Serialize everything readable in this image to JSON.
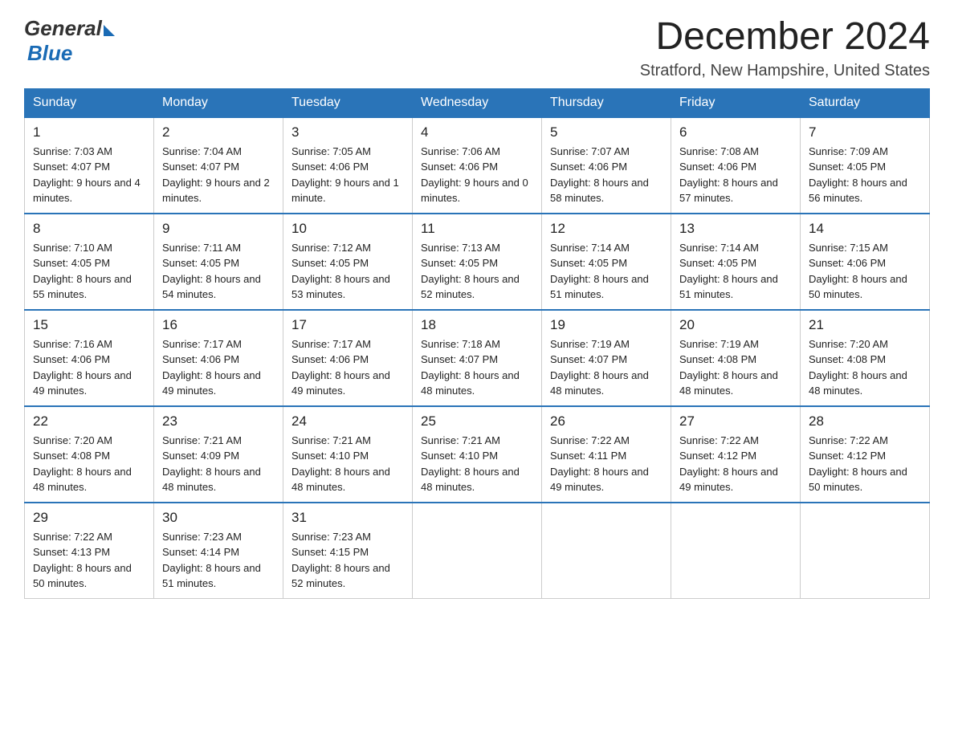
{
  "logo": {
    "general": "General",
    "blue": "Blue"
  },
  "header": {
    "month_title": "December 2024",
    "location": "Stratford, New Hampshire, United States"
  },
  "weekdays": [
    "Sunday",
    "Monday",
    "Tuesday",
    "Wednesday",
    "Thursday",
    "Friday",
    "Saturday"
  ],
  "weeks": [
    [
      {
        "day": "1",
        "sunrise": "7:03 AM",
        "sunset": "4:07 PM",
        "daylight": "9 hours and 4 minutes."
      },
      {
        "day": "2",
        "sunrise": "7:04 AM",
        "sunset": "4:07 PM",
        "daylight": "9 hours and 2 minutes."
      },
      {
        "day": "3",
        "sunrise": "7:05 AM",
        "sunset": "4:06 PM",
        "daylight": "9 hours and 1 minute."
      },
      {
        "day": "4",
        "sunrise": "7:06 AM",
        "sunset": "4:06 PM",
        "daylight": "9 hours and 0 minutes."
      },
      {
        "day": "5",
        "sunrise": "7:07 AM",
        "sunset": "4:06 PM",
        "daylight": "8 hours and 58 minutes."
      },
      {
        "day": "6",
        "sunrise": "7:08 AM",
        "sunset": "4:06 PM",
        "daylight": "8 hours and 57 minutes."
      },
      {
        "day": "7",
        "sunrise": "7:09 AM",
        "sunset": "4:05 PM",
        "daylight": "8 hours and 56 minutes."
      }
    ],
    [
      {
        "day": "8",
        "sunrise": "7:10 AM",
        "sunset": "4:05 PM",
        "daylight": "8 hours and 55 minutes."
      },
      {
        "day": "9",
        "sunrise": "7:11 AM",
        "sunset": "4:05 PM",
        "daylight": "8 hours and 54 minutes."
      },
      {
        "day": "10",
        "sunrise": "7:12 AM",
        "sunset": "4:05 PM",
        "daylight": "8 hours and 53 minutes."
      },
      {
        "day": "11",
        "sunrise": "7:13 AM",
        "sunset": "4:05 PM",
        "daylight": "8 hours and 52 minutes."
      },
      {
        "day": "12",
        "sunrise": "7:14 AM",
        "sunset": "4:05 PM",
        "daylight": "8 hours and 51 minutes."
      },
      {
        "day": "13",
        "sunrise": "7:14 AM",
        "sunset": "4:05 PM",
        "daylight": "8 hours and 51 minutes."
      },
      {
        "day": "14",
        "sunrise": "7:15 AM",
        "sunset": "4:06 PM",
        "daylight": "8 hours and 50 minutes."
      }
    ],
    [
      {
        "day": "15",
        "sunrise": "7:16 AM",
        "sunset": "4:06 PM",
        "daylight": "8 hours and 49 minutes."
      },
      {
        "day": "16",
        "sunrise": "7:17 AM",
        "sunset": "4:06 PM",
        "daylight": "8 hours and 49 minutes."
      },
      {
        "day": "17",
        "sunrise": "7:17 AM",
        "sunset": "4:06 PM",
        "daylight": "8 hours and 49 minutes."
      },
      {
        "day": "18",
        "sunrise": "7:18 AM",
        "sunset": "4:07 PM",
        "daylight": "8 hours and 48 minutes."
      },
      {
        "day": "19",
        "sunrise": "7:19 AM",
        "sunset": "4:07 PM",
        "daylight": "8 hours and 48 minutes."
      },
      {
        "day": "20",
        "sunrise": "7:19 AM",
        "sunset": "4:08 PM",
        "daylight": "8 hours and 48 minutes."
      },
      {
        "day": "21",
        "sunrise": "7:20 AM",
        "sunset": "4:08 PM",
        "daylight": "8 hours and 48 minutes."
      }
    ],
    [
      {
        "day": "22",
        "sunrise": "7:20 AM",
        "sunset": "4:08 PM",
        "daylight": "8 hours and 48 minutes."
      },
      {
        "day": "23",
        "sunrise": "7:21 AM",
        "sunset": "4:09 PM",
        "daylight": "8 hours and 48 minutes."
      },
      {
        "day": "24",
        "sunrise": "7:21 AM",
        "sunset": "4:10 PM",
        "daylight": "8 hours and 48 minutes."
      },
      {
        "day": "25",
        "sunrise": "7:21 AM",
        "sunset": "4:10 PM",
        "daylight": "8 hours and 48 minutes."
      },
      {
        "day": "26",
        "sunrise": "7:22 AM",
        "sunset": "4:11 PM",
        "daylight": "8 hours and 49 minutes."
      },
      {
        "day": "27",
        "sunrise": "7:22 AM",
        "sunset": "4:12 PM",
        "daylight": "8 hours and 49 minutes."
      },
      {
        "day": "28",
        "sunrise": "7:22 AM",
        "sunset": "4:12 PM",
        "daylight": "8 hours and 50 minutes."
      }
    ],
    [
      {
        "day": "29",
        "sunrise": "7:22 AM",
        "sunset": "4:13 PM",
        "daylight": "8 hours and 50 minutes."
      },
      {
        "day": "30",
        "sunrise": "7:23 AM",
        "sunset": "4:14 PM",
        "daylight": "8 hours and 51 minutes."
      },
      {
        "day": "31",
        "sunrise": "7:23 AM",
        "sunset": "4:15 PM",
        "daylight": "8 hours and 52 minutes."
      },
      null,
      null,
      null,
      null
    ]
  ]
}
